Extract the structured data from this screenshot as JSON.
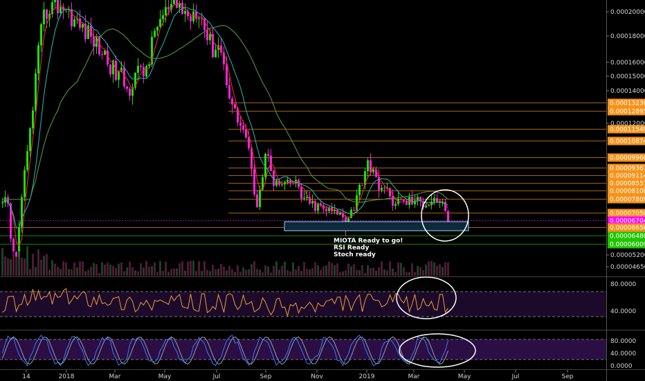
{
  "chart_data": [
    {
      "type": "candlestick",
      "x_ticks": [
        "14",
        "2018",
        "Mar",
        "May",
        "Jul",
        "Sep",
        "Nov",
        "2019",
        "Mar",
        "May",
        "Jul",
        "Sep"
      ],
      "y_ticks": [
        "0.00020000",
        "0.00018000",
        "0.00016000",
        "0.00015000",
        "0.00014000",
        "0.00012000",
        "0.00005200",
        "0.00004650"
      ],
      "price_levels": [
        {
          "value": "0.00013238",
          "color": "#f7931a"
        },
        {
          "value": "0.00012895",
          "color": "#f7931a"
        },
        {
          "value": "0.00011549",
          "color": "#f7931a"
        },
        {
          "value": "0.00010874",
          "color": "#f7931a"
        },
        {
          "value": "0.00009960",
          "color": "#f7931a"
        },
        {
          "value": "0.00009361",
          "color": "#f7931a"
        },
        {
          "value": "0.00009114",
          "color": "#f7931a"
        },
        {
          "value": "0.00008557",
          "color": "#f7931a"
        },
        {
          "value": "0.00008108",
          "color": "#f7931a"
        },
        {
          "value": "0.00007809",
          "color": "#f7931a"
        },
        {
          "value": "0.00007050",
          "color": "#f7931a"
        },
        {
          "value": "0.00006704",
          "color": "#ff00ff"
        },
        {
          "value": "0.00006656",
          "color": "#f7931a"
        },
        {
          "value": "0.00006480",
          "color": "#21c400"
        },
        {
          "value": "0.00006009",
          "color": "#21c400"
        }
      ],
      "annotations": [
        "MIOTA Ready to go!",
        "RSI Ready",
        "Stoch ready"
      ],
      "trend": "0.00019 peak near 2018, decline through 2018 to 0.00006704 in April 2019"
    },
    {
      "type": "line",
      "name": "RSI",
      "y_ticks": [
        "80.0000",
        "40.0000"
      ]
    },
    {
      "type": "line",
      "name": "Stoch",
      "y_ticks": [
        "80.0000",
        "40.0000",
        "0.0000"
      ]
    }
  ],
  "colors": {
    "up_candle": "#21e000",
    "down_candle": "#ff22dd",
    "ma_fast": "#e53030",
    "ma_mid": "#2aa9a9",
    "ma_slow": "#4e8a3a",
    "rsi_line": "#f09b3c",
    "stoch_k": "#3a7cff",
    "stoch_d": "#9aa0aa",
    "band_fill": "#1c0a2a",
    "level_line": "#f7931a"
  }
}
